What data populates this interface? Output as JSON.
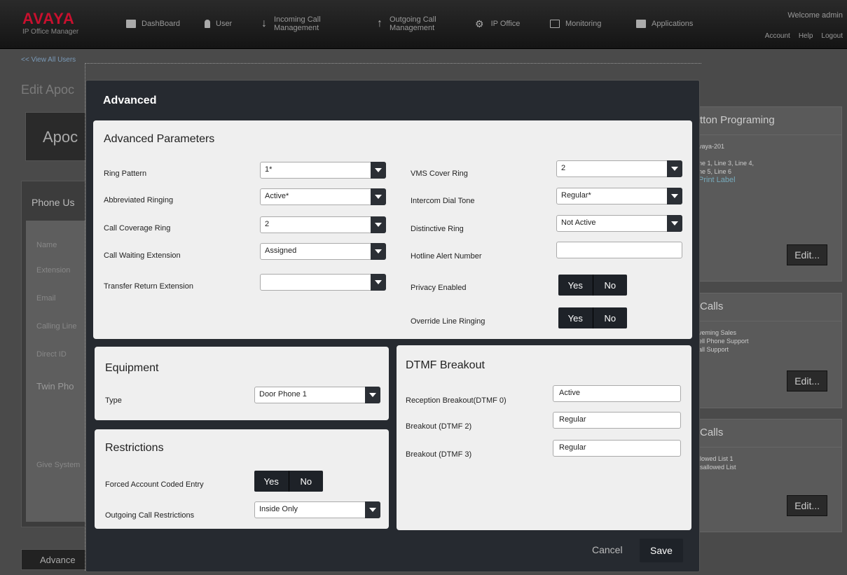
{
  "header": {
    "logo": "AVAYA",
    "product": "IP Office Manager",
    "nav": [
      {
        "label": "DashBoard",
        "icon": "dashboard-icon"
      },
      {
        "label": "User",
        "icon": "user-icon"
      },
      {
        "label": "Incoming Call\nManagement",
        "icon": "arrow-down-icon"
      },
      {
        "label": "Outgoing Call\nManagement",
        "icon": "arrow-up-icon"
      },
      {
        "label": "IP Office",
        "icon": "gear-icon"
      },
      {
        "label": "Monitoring",
        "icon": "monitor-icon"
      },
      {
        "label": "Applications",
        "icon": "applications-icon"
      }
    ],
    "welcome": "Welcome admin",
    "links": [
      "Account",
      "Help",
      "Logout"
    ]
  },
  "background": {
    "back_link": "<< View All Users",
    "title": "Edit Apoc",
    "name_card": "Apoc",
    "phone_users": "Phone Us",
    "left_labels": [
      "Name",
      "Extension",
      "Email",
      "Calling Line",
      "Direct ID",
      "Twin Pho",
      "Give System"
    ],
    "advanced_button": "Advance",
    "right": [
      {
        "title": "tton Programing",
        "lines": [
          "vaya-201",
          "",
          "ne 1, Line 3, Line 4,",
          "ne 5, Line 6",
          "Print Label"
        ],
        "edit": "Edit..."
      },
      {
        "title": "Calls",
        "lines": [
          "veming Sales",
          "ell Phone Support",
          "all Support"
        ],
        "edit": "Edit..."
      },
      {
        "title": "Calls",
        "lines": [
          "llowed List 1",
          "isallowed List"
        ],
        "edit": "Edit..."
      }
    ]
  },
  "modal": {
    "title": "Advanced",
    "advanced_params": {
      "heading": "Advanced Parameters",
      "left": [
        {
          "label": "Ring Pattern",
          "value": "1*",
          "kind": "select"
        },
        {
          "label": "Abbreviated Ringing",
          "value": "Active*",
          "kind": "select"
        },
        {
          "label": "Call Coverage Ring",
          "value": "2",
          "kind": "select"
        },
        {
          "label": "Call Waiting Extension",
          "value": "Assigned",
          "kind": "select"
        },
        {
          "label": "Transfer Return Extension",
          "value": "",
          "kind": "select"
        }
      ],
      "right": [
        {
          "label": "VMS Cover Ring",
          "value": "2",
          "kind": "select"
        },
        {
          "label": "Intercom Dial Tone",
          "value": "Regular*",
          "kind": "select"
        },
        {
          "label": "Distinctive Ring",
          "value": "Not Active",
          "kind": "select"
        },
        {
          "label": "Hotline Alert Number",
          "value": "",
          "kind": "text"
        },
        {
          "label": "Privacy Enabled",
          "yes": "Yes",
          "no": "No",
          "kind": "toggle"
        },
        {
          "label": "Override Line Ringing",
          "yes": "Yes",
          "no": "No",
          "kind": "toggle"
        }
      ]
    },
    "equipment": {
      "heading": "Equipment",
      "type_label": "Type",
      "type_value": "Door Phone 1"
    },
    "restrictions": {
      "heading": "Restrictions",
      "forced_label": "Forced Account Coded Entry",
      "yes": "Yes",
      "no": "No",
      "outgoing_label": "Outgoing Call Restrictions",
      "outgoing_value": "Inside Only"
    },
    "dtmf": {
      "heading": "DTMF Breakout",
      "rows": [
        {
          "label": "Reception Breakout(DTMF 0)",
          "value": "Active"
        },
        {
          "label": "Breakout (DTMF 2)",
          "value": "Regular"
        },
        {
          "label": "Breakout (DTMF 3)",
          "value": "Regular"
        }
      ]
    },
    "cancel": "Cancel",
    "save": "Save"
  }
}
